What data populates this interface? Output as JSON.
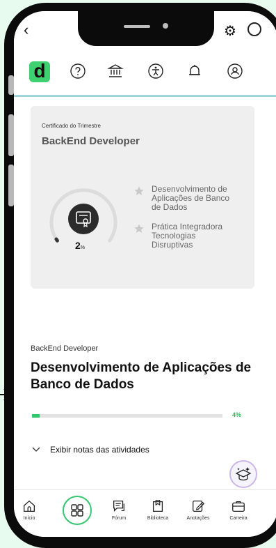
{
  "app": {
    "logo_letter": "d",
    "accent": "#3ed16f",
    "nav_icons": [
      "help-icon",
      "bank-icon",
      "accessibility-icon",
      "bell-icon",
      "profile-icon"
    ]
  },
  "certificate": {
    "label": "Certificado do Trimestre",
    "title": "BackEnd Developer",
    "progress_value": "2",
    "progress_unit": "%",
    "modules": [
      {
        "name": "Desenvolvimento de Aplicações de Banco de Dados",
        "lines": [
          "Desenvolvimento de",
          "Aplicações de Banco",
          "de Dados"
        ]
      },
      {
        "name": "Prática Integradora Tecnologias Disruptivas",
        "lines": [
          "Prática Integradora",
          "Tecnologias",
          "Disruptivas"
        ]
      }
    ]
  },
  "course": {
    "subtitle": "BackEnd Developer",
    "title": "Desenvolvimento de Aplicações de Banco de Dados",
    "progress_label": "4%",
    "progress_fraction": 0.04,
    "notes_toggle": "Exibir notas das atividades"
  },
  "bottom_nav": {
    "items": [
      {
        "label": "Início",
        "icon": "home-icon"
      },
      {
        "label": "",
        "icon": "grid-icon"
      },
      {
        "label": "Fórum",
        "icon": "forum-icon"
      },
      {
        "label": "Biblioteca",
        "icon": "library-icon"
      },
      {
        "label": "Anotações",
        "icon": "notes-icon"
      },
      {
        "label": "Carreira",
        "icon": "career-icon"
      }
    ]
  }
}
